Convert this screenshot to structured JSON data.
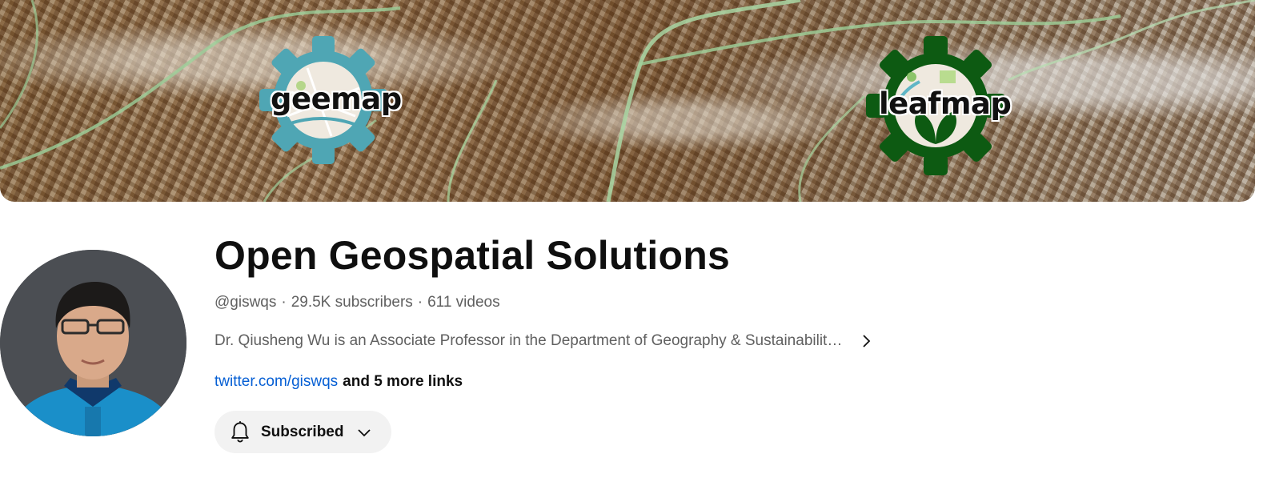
{
  "banner": {
    "logos": [
      {
        "text": "geemap",
        "color": "#4fa6b4"
      },
      {
        "text": "leafmap",
        "color": "#0d5a12"
      }
    ]
  },
  "channel": {
    "name": "Open Geospatial Solutions",
    "handle": "@giswqs",
    "subscribers": "29.5K subscribers",
    "videos": "611 videos",
    "separator": "·",
    "description": "Dr. Qiusheng Wu is an Associate Professor in the Department of Geography & Sustainabilit…",
    "link": "twitter.com/giswqs",
    "more_links": "and 5 more links",
    "subscribe_label": "Subscribed"
  },
  "icons": {
    "description_expand": "chevron-right-icon",
    "subscribe_bell": "bell-icon",
    "subscribe_menu": "chevron-down-icon"
  },
  "colors": {
    "link": "#065fd4",
    "button_bg": "#f2f2f2",
    "meta_text": "#606060"
  }
}
